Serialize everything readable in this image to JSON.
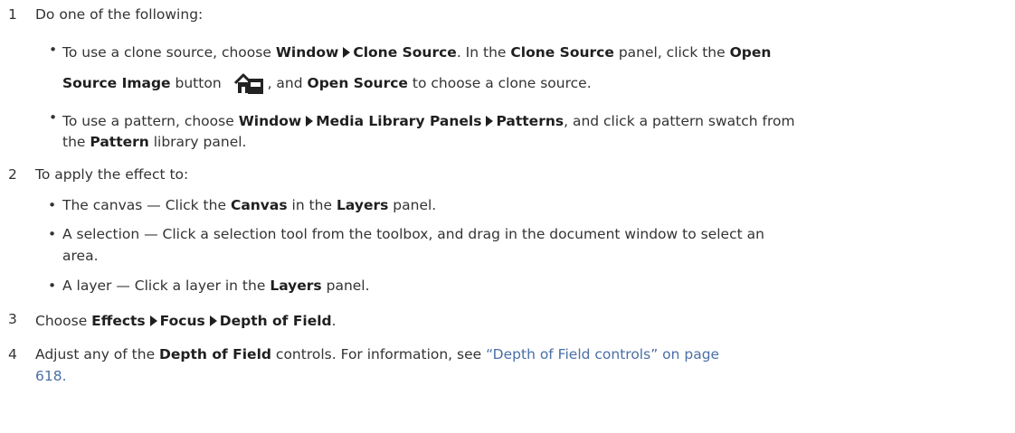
{
  "steps": [
    {
      "num": "1",
      "text": "Do one of the following:"
    },
    {
      "num": "2",
      "text": "To apply the effect to:"
    },
    {
      "num": "3",
      "text": "Choose"
    },
    {
      "num": "4",
      "text": "Adjust any of the"
    }
  ],
  "step1": {
    "b1": {
      "t1": "To use a clone source, choose",
      "m1": "Window",
      "m2": "Clone Source",
      "t2": ". In the",
      "panel": "Clone Source",
      "t3": "panel, click the",
      "btn_a": "Open",
      "btn_b": "Source Image",
      "t4": "button",
      "t5": ", and",
      "btn2": "Open Source",
      "t6": "to choose a clone source."
    },
    "b2": {
      "t1": "To use a pattern, choose",
      "m1": "Window",
      "m2": "Media Library Panels",
      "m3": "Patterns",
      "t2": ", and click a pattern swatch from",
      "t3": "the",
      "panel": "Pattern",
      "t4": "library panel."
    }
  },
  "step2": {
    "b1": {
      "t1": "The canvas — Click the",
      "k1": "Canvas",
      "t2": "in the",
      "k2": "Layers",
      "t3": "panel."
    },
    "b2": {
      "l1": "A selection — Click a selection tool from the toolbox, and drag in the document window to select an",
      "l2": "area."
    },
    "b3": {
      "t1": "A layer — Click a layer in the",
      "k1": "Layers",
      "t2": "panel."
    }
  },
  "step3": {
    "m1": "Effects",
    "m2": "Focus",
    "m3": "Depth of Field",
    "end": "."
  },
  "step4": {
    "k1": "Depth of Field",
    "t2": "controls. For information, see",
    "link1": "“Depth of Field controls” on page",
    "link2": "618."
  },
  "bullet": "•",
  "icons": {
    "open_source_image": "house-folder-icon",
    "menu_arrow": "triangle-right-icon"
  }
}
